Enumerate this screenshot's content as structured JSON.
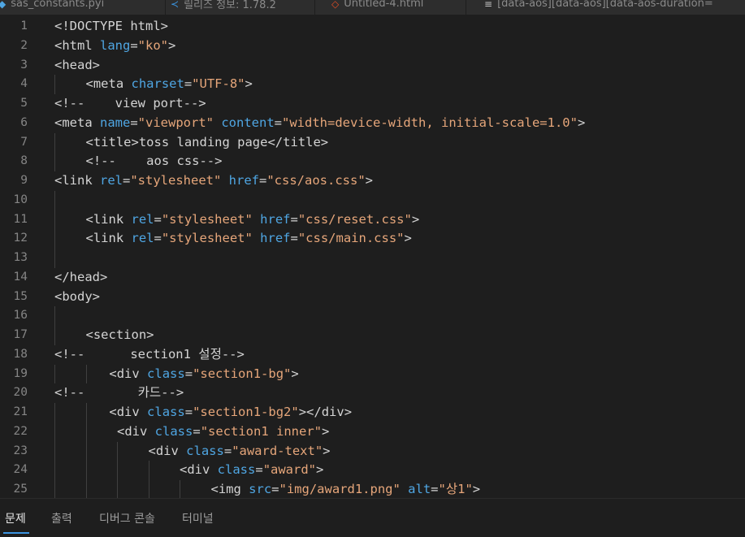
{
  "tabs": [
    {
      "label": "sas_constants.pyi",
      "icon": "python-file-icon",
      "color": "#4fa6e3"
    },
    {
      "label": "릴리즈 정보: 1.78.2",
      "icon": "vscode-logo-icon",
      "color": "#3b94e0"
    },
    {
      "label": "Untitled-4.html",
      "icon": "html-file-icon",
      "color": "#e44d26"
    },
    {
      "label": "[data-aos][data-aos][data-aos-duration=",
      "icon": "css-file-icon",
      "color": "#c5c5c5"
    }
  ],
  "lines": [
    {
      "n": "1",
      "indent": 0,
      "guides": 0,
      "tokens": [
        [
          "t",
          "<!DOCTYPE html>"
        ]
      ]
    },
    {
      "n": "2",
      "indent": 0,
      "guides": 0,
      "tokens": [
        [
          "t",
          "<html "
        ],
        [
          "a",
          "lang"
        ],
        [
          "e",
          "="
        ],
        [
          "s",
          "\"ko\""
        ],
        [
          "t",
          ">"
        ]
      ]
    },
    {
      "n": "3",
      "indent": 0,
      "guides": 0,
      "tokens": [
        [
          "t",
          "<head>"
        ]
      ]
    },
    {
      "n": "4",
      "indent": 1,
      "guides": 1,
      "tokens": [
        [
          "t",
          "<meta "
        ],
        [
          "a",
          "charset"
        ],
        [
          "e",
          "="
        ],
        [
          "s",
          "\"UTF-8\""
        ],
        [
          "t",
          ">"
        ]
      ]
    },
    {
      "n": "5",
      "indent": 0,
      "guides": 0,
      "tokens": [
        [
          "c",
          "<!--    view port-->"
        ]
      ]
    },
    {
      "n": "6",
      "indent": 0,
      "guides": 0,
      "tokens": [
        [
          "t",
          "<meta "
        ],
        [
          "a",
          "name"
        ],
        [
          "e",
          "="
        ],
        [
          "s",
          "\"viewport\""
        ],
        [
          "t",
          " "
        ],
        [
          "a",
          "content"
        ],
        [
          "e",
          "="
        ],
        [
          "s",
          "\"width=device-width, initial-scale=1.0\""
        ],
        [
          "t",
          ">"
        ]
      ]
    },
    {
      "n": "7",
      "indent": 1,
      "guides": 1,
      "tokens": [
        [
          "t",
          "<title>"
        ],
        [
          "x",
          "toss landing page"
        ],
        [
          "t",
          "</title>"
        ]
      ]
    },
    {
      "n": "8",
      "indent": 1,
      "guides": 1,
      "tokens": [
        [
          "c",
          "<!--    aos css-->"
        ]
      ]
    },
    {
      "n": "9",
      "indent": 0,
      "guides": 0,
      "tokens": [
        [
          "t",
          "<link "
        ],
        [
          "a",
          "rel"
        ],
        [
          "e",
          "="
        ],
        [
          "s",
          "\"stylesheet\""
        ],
        [
          "t",
          " "
        ],
        [
          "a",
          "href"
        ],
        [
          "e",
          "="
        ],
        [
          "s",
          "\"css/aos.css\""
        ],
        [
          "t",
          ">"
        ]
      ]
    },
    {
      "n": "10",
      "indent": 0,
      "guides": 1,
      "tokens": []
    },
    {
      "n": "11",
      "indent": 1,
      "guides": 1,
      "tokens": [
        [
          "t",
          "<link "
        ],
        [
          "a",
          "rel"
        ],
        [
          "e",
          "="
        ],
        [
          "s",
          "\"stylesheet\""
        ],
        [
          "t",
          " "
        ],
        [
          "a",
          "href"
        ],
        [
          "e",
          "="
        ],
        [
          "s",
          "\"css/reset.css\""
        ],
        [
          "t",
          ">"
        ]
      ]
    },
    {
      "n": "12",
      "indent": 1,
      "guides": 1,
      "tokens": [
        [
          "t",
          "<link "
        ],
        [
          "a",
          "rel"
        ],
        [
          "e",
          "="
        ],
        [
          "s",
          "\"stylesheet\""
        ],
        [
          "t",
          " "
        ],
        [
          "a",
          "href"
        ],
        [
          "e",
          "="
        ],
        [
          "s",
          "\"css/main.css\""
        ],
        [
          "t",
          ">"
        ]
      ]
    },
    {
      "n": "13",
      "indent": 0,
      "guides": 1,
      "tokens": []
    },
    {
      "n": "14",
      "indent": 0,
      "guides": 0,
      "tokens": [
        [
          "t",
          "</head>"
        ]
      ]
    },
    {
      "n": "15",
      "indent": 0,
      "guides": 0,
      "tokens": [
        [
          "t",
          "<body>"
        ]
      ]
    },
    {
      "n": "16",
      "indent": 0,
      "guides": 1,
      "tokens": []
    },
    {
      "n": "17",
      "indent": 1,
      "guides": 1,
      "tokens": [
        [
          "t",
          "<section>"
        ]
      ]
    },
    {
      "n": "18",
      "indent": 0,
      "guides": 0,
      "tokens": [
        [
          "c",
          "<!--      section1 설정-->"
        ]
      ]
    },
    {
      "n": "19",
      "indent": 1.75,
      "guides": 2,
      "tokens": [
        [
          "t",
          "<div "
        ],
        [
          "a",
          "class"
        ],
        [
          "e",
          "="
        ],
        [
          "s",
          "\"section1-bg\""
        ],
        [
          "t",
          ">"
        ]
      ]
    },
    {
      "n": "20",
      "indent": 0,
      "guides": 0,
      "tokens": [
        [
          "c",
          "<!--       카드-->"
        ]
      ]
    },
    {
      "n": "21",
      "indent": 1.75,
      "guides": 2,
      "tokens": [
        [
          "t",
          "<div "
        ],
        [
          "a",
          "class"
        ],
        [
          "e",
          "="
        ],
        [
          "s",
          "\"section1-bg2\""
        ],
        [
          "t",
          "></div>"
        ]
      ]
    },
    {
      "n": "22",
      "indent": 2,
      "guides": 2,
      "tokens": [
        [
          "t",
          "<div "
        ],
        [
          "a",
          "class"
        ],
        [
          "e",
          "="
        ],
        [
          "s",
          "\"section1 inner\""
        ],
        [
          "t",
          ">"
        ]
      ]
    },
    {
      "n": "23",
      "indent": 3,
      "guides": 3,
      "tokens": [
        [
          "t",
          "<div "
        ],
        [
          "a",
          "class"
        ],
        [
          "e",
          "="
        ],
        [
          "s",
          "\"award-text\""
        ],
        [
          "t",
          ">"
        ]
      ]
    },
    {
      "n": "24",
      "indent": 4,
      "guides": 4,
      "tokens": [
        [
          "t",
          "<div "
        ],
        [
          "a",
          "class"
        ],
        [
          "e",
          "="
        ],
        [
          "s",
          "\"award\""
        ],
        [
          "t",
          ">"
        ]
      ]
    },
    {
      "n": "25",
      "indent": 5,
      "guides": 5,
      "tokens": [
        [
          "t",
          "<img "
        ],
        [
          "a",
          "src"
        ],
        [
          "e",
          "="
        ],
        [
          "s",
          "\"img/award1.png\""
        ],
        [
          "t",
          " "
        ],
        [
          "a",
          "alt"
        ],
        [
          "e",
          "="
        ],
        [
          "s",
          "\"상1\""
        ],
        [
          "t",
          ">"
        ]
      ]
    }
  ],
  "panel": {
    "tabs": [
      {
        "label": "문제",
        "active": true
      },
      {
        "label": "출력",
        "active": false
      },
      {
        "label": "디버그 콘솔",
        "active": false
      },
      {
        "label": "터미널",
        "active": false
      }
    ]
  }
}
